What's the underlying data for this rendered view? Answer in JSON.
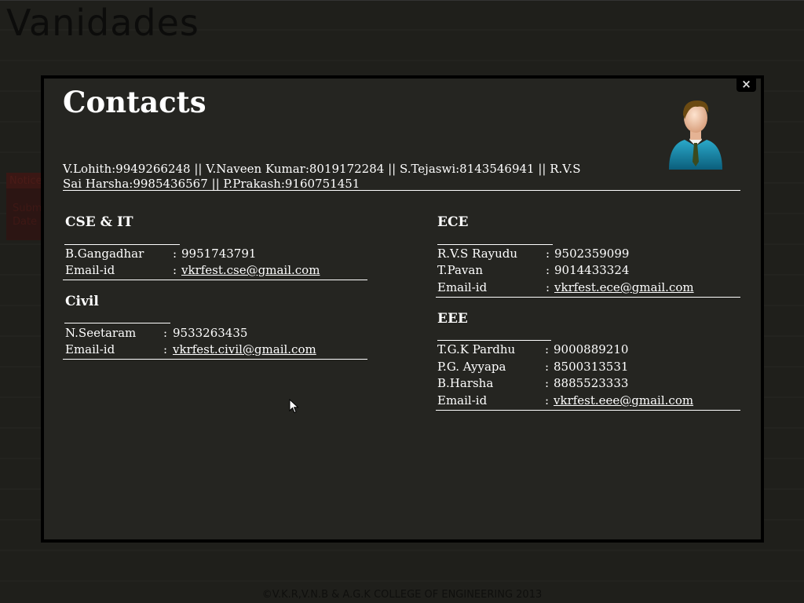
{
  "background": {
    "site_title": "Vanidades",
    "notice_title": "Notice",
    "notice_lines": [
      "Subm",
      "Date"
    ],
    "footer": "©V.K.R,V.N.B & A.G.K COLLEGE OF ENGINEERING 2013"
  },
  "modal": {
    "title": "Contacts",
    "close_label": "×",
    "coordinators": "V.Lohith:9949266248 || V.Naveen Kumar:8019172284 || S.Tejaswi:8143546941 || R.V.S Sai Harsha:9985436567 || P.Prakash:9160751451",
    "sections": {
      "cse": {
        "title": "CSE & IT",
        "rows": [
          {
            "label": "B.Gangadhar",
            "value": "9951743791"
          },
          {
            "label": "Email-id",
            "value": "vkrfest.cse@gmail.com"
          }
        ]
      },
      "civil": {
        "title": "Civil",
        "rows": [
          {
            "label": "N.Seetaram",
            "value": "9533263435"
          },
          {
            "label": "Email-id",
            "value": "vkrfest.civil@gmail.com"
          }
        ]
      },
      "ece": {
        "title": "ECE",
        "rows": [
          {
            "label": "R.V.S Rayudu",
            "value": "9502359099"
          },
          {
            "label": "T.Pavan",
            "value": "9014433324"
          },
          {
            "label": "Email-id",
            "value": "vkrfest.ece@gmail.com"
          }
        ]
      },
      "eee": {
        "title": "EEE",
        "rows": [
          {
            "label": "T.G.K Pardhu",
            "value": "9000889210"
          },
          {
            "label": "P.G. Ayyapa",
            "value": "8500313531"
          },
          {
            "label": "B.Harsha",
            "value": "8885523333"
          },
          {
            "label": "Email-id",
            "value": "vkrfest.eee@gmail.com"
          }
        ]
      }
    },
    "separator": ":"
  },
  "icons": {
    "avatar": "businessman-avatar-icon",
    "close": "close-icon",
    "cursor": "mouse-pointer-icon"
  }
}
